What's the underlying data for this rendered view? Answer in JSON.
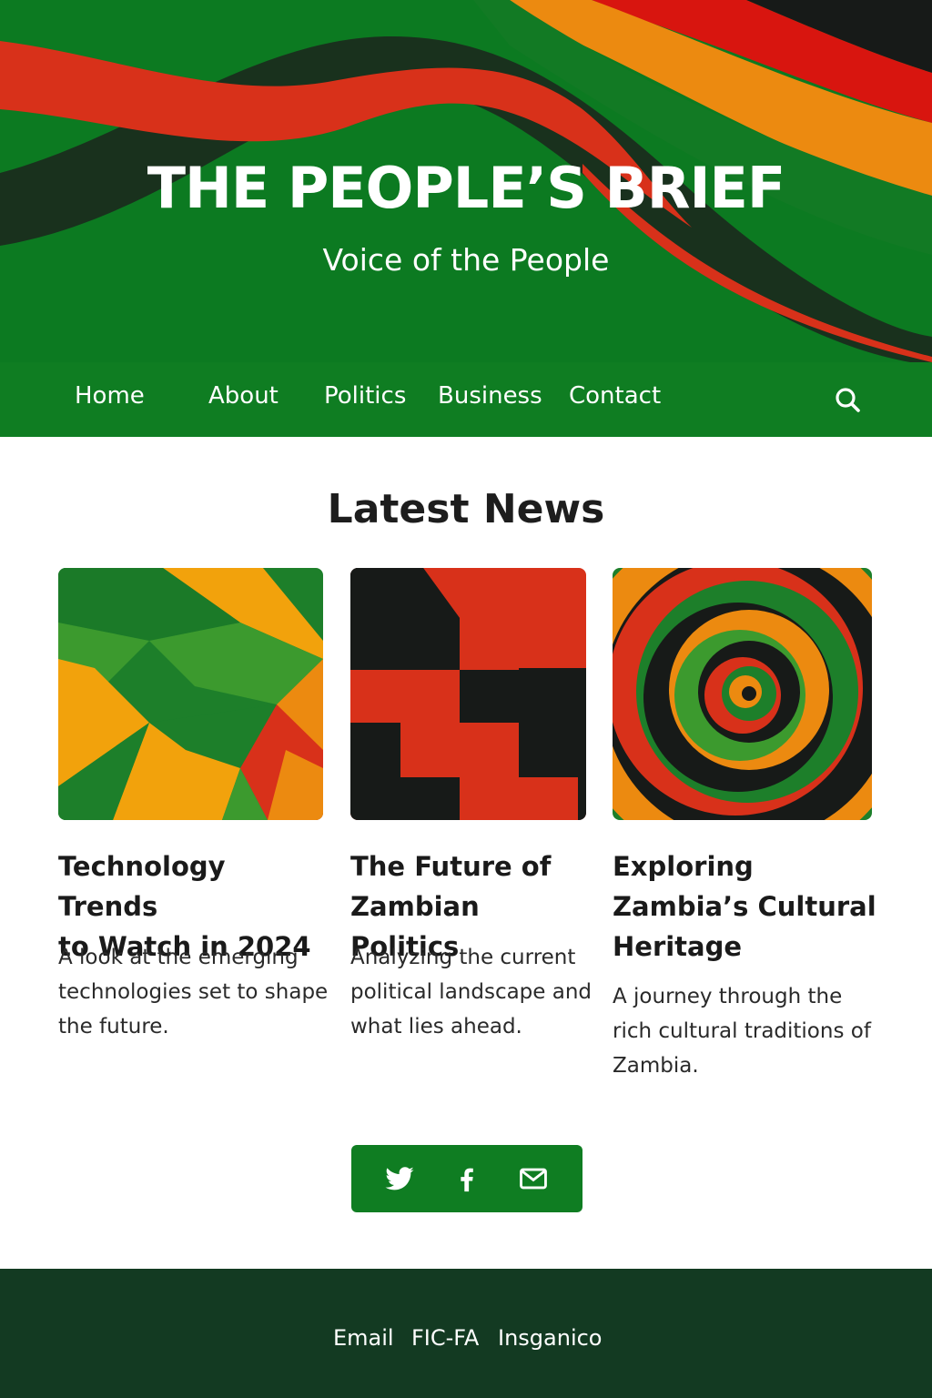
{
  "header": {
    "title": "THE PEOPLE’S BRIEF",
    "subtitle": "Voice of the People"
  },
  "nav": {
    "items": [
      {
        "label": "Home"
      },
      {
        "label": "About"
      },
      {
        "label": "Politics"
      },
      {
        "label": "Business"
      },
      {
        "label": "Contact"
      }
    ],
    "search_icon": "search-icon"
  },
  "main": {
    "section_title": "Latest News",
    "articles": [
      {
        "title_lines": [
          "Technology Trends",
          "to Watch in 2024"
        ],
        "desc_lines": [
          "A look at the emerging",
          "technologies set to shape",
          "the future."
        ],
        "image": "geometric-pattern"
      },
      {
        "title_lines": [
          "The Future of",
          "Zambian Politics"
        ],
        "desc_lines": [
          "Analyzing the current",
          "political landscape and",
          "what lies ahead."
        ],
        "image": "stepped-blocks-pattern"
      },
      {
        "title_lines": [
          "Exploring",
          "Zambia’s Cultural",
          "Heritage"
        ],
        "desc_lines": [
          "A journey through the",
          "rich cultural traditions of",
          "Zambia."
        ],
        "image": "spiral-pattern"
      }
    ]
  },
  "social": {
    "icons": [
      "twitter-icon",
      "facebook-icon",
      "mail-icon"
    ]
  },
  "footer": {
    "links": [
      "Email",
      "FIC-FA",
      "Insganico"
    ]
  },
  "colors": {
    "green": "#0f7d22",
    "dark_green": "#133a22",
    "red": "#d8311a",
    "orange": "#ec8a10",
    "yellow": "#f2a20c",
    "black": "#171a18"
  }
}
